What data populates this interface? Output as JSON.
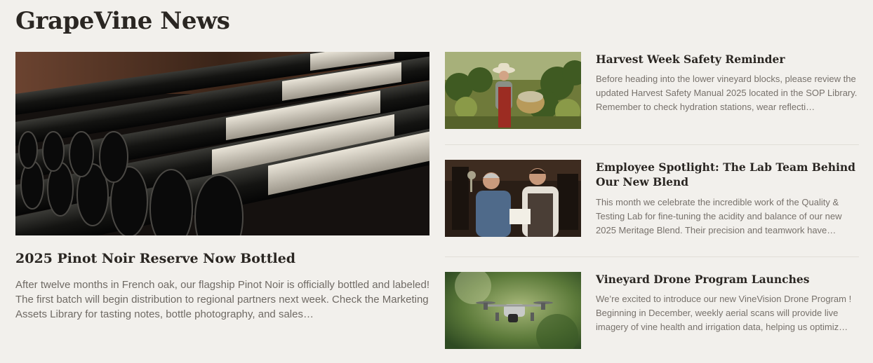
{
  "page": {
    "title": "GrapeVine News"
  },
  "featured": {
    "image_icon": "wine-bottles-image",
    "title": "2025 Pinot Noir Reserve Now Bottled",
    "body": "After twelve months in French oak, our flagship Pinot Noir is officially bottled and labeled! The first batch will begin distribution to regional partners next week. Check the Marketing Assets Library for tasting notes, bottle photography, and sales…"
  },
  "articles": [
    {
      "image_icon": "vineyard-worker-image",
      "title": "Harvest Week Safety Reminder",
      "body": "Before heading into the lower vineyard blocks, please review the updated Harvest Safety Manual 2025 located in the SOP Library. Remember to check hydration stations, wear reflecti…"
    },
    {
      "image_icon": "lab-team-image",
      "title": "Employee Spotlight: The Lab Team Behind Our New Blend",
      "body": "This month we celebrate the incredible work of the Quality & Testing Lab for fine-tuning the acidity and balance of our new 2025 Meritage Blend. Their precision and teamwork have…"
    },
    {
      "image_icon": "drone-image",
      "title": "Vineyard Drone Program Launches",
      "body": "We’re excited to introduce our new VineVision Drone Program ! Beginning in December, weekly aerial scans will provide live imagery of vine health and irrigation data, helping us optimiz…"
    }
  ],
  "colors": {
    "background": "#f2f0ec",
    "title": "#2a2622",
    "body_text": "#6f6a64",
    "divider": "#e1ded8"
  }
}
